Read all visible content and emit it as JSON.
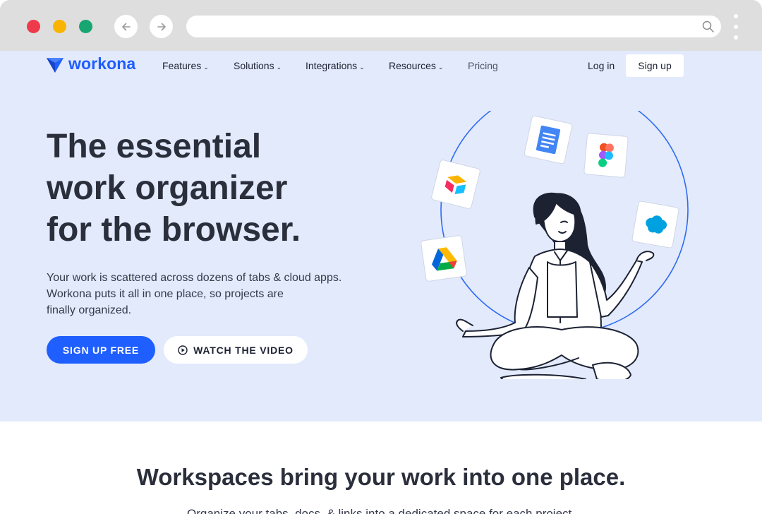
{
  "browser": {
    "url_value": "",
    "icons": [
      "back-arrow-icon",
      "forward-arrow-icon",
      "search-icon",
      "kebab-menu-icon"
    ]
  },
  "nav": {
    "logo": "workona",
    "items": [
      {
        "label": "Features",
        "has_dropdown": true
      },
      {
        "label": "Solutions",
        "has_dropdown": true
      },
      {
        "label": "Integrations",
        "has_dropdown": true
      },
      {
        "label": "Resources",
        "has_dropdown": true
      },
      {
        "label": "Pricing",
        "has_dropdown": false
      }
    ],
    "login": "Log in",
    "signup": "Sign up"
  },
  "hero": {
    "headline_lines": [
      "The essential",
      "work organizer",
      "for the browser."
    ],
    "sub_lines": [
      "Your work is scattered across dozens of tabs & cloud apps.",
      "Workona puts it all in one place, so projects are",
      "finally organized."
    ],
    "cta_primary": "SIGN UP FREE",
    "cta_secondary": "WATCH THE VIDEO",
    "app_icons": [
      "google-docs-icon",
      "figma-icon",
      "airtable-icon",
      "salesforce-icon",
      "google-drive-icon"
    ]
  },
  "section2": {
    "title": "Workspaces bring your work into one place.",
    "subtitle": "Organize your tabs, docs, & links into a dedicated space for each project."
  },
  "colors": {
    "brand_blue": "#1f5eff",
    "hero_bg": "#e2eafc",
    "text_dark": "#2b2f3c",
    "chrome_gray": "#dedede"
  }
}
